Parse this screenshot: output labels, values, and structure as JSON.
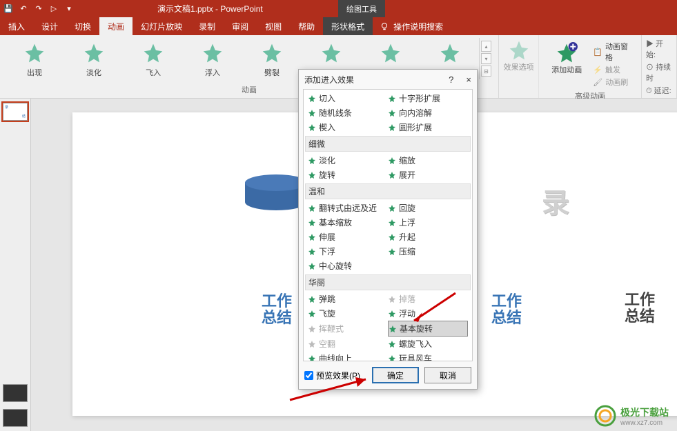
{
  "title": "演示文稿1.pptx  -  PowerPoint",
  "context_group": "绘图工具",
  "tabs": {
    "insert": "插入",
    "design": "设计",
    "transition": "切换",
    "animation": "动画",
    "slideshow": "幻灯片放映",
    "record": "录制",
    "review": "审阅",
    "view": "视图",
    "help": "帮助",
    "shape_format": "形状格式",
    "tell_me": "操作说明搜索"
  },
  "gallery": {
    "items": [
      "出现",
      "淡化",
      "飞入",
      "浮入",
      "劈裂"
    ],
    "group_label": "动画",
    "effect_options": "效果选项",
    "add_animation": "添加动画",
    "adv_group": "高级动画",
    "anim_pane": "动画窗格",
    "trigger": "触发",
    "anim_painter": "动画刷",
    "timing_start": "开始:",
    "timing_duration": "持续时",
    "timing_delay": "延迟:"
  },
  "dialog": {
    "title": "添加进入效果",
    "help": "?",
    "close": "×",
    "rows_basic": [
      [
        "切入",
        "十字形扩展"
      ],
      [
        "随机线条",
        "向内溶解"
      ],
      [
        "楔入",
        "圆形扩展"
      ]
    ],
    "group_subtle": "细微",
    "rows_subtle": [
      [
        "淡化",
        "缩放"
      ],
      [
        "旋转",
        "展开"
      ]
    ],
    "group_moderate": "温和",
    "rows_moderate": [
      [
        "翻转式由远及近",
        "回旋"
      ],
      [
        "基本缩放",
        "上浮"
      ],
      [
        "伸展",
        "升起"
      ],
      [
        "下浮",
        "压缩"
      ],
      [
        "中心旋转",
        ""
      ]
    ],
    "group_exciting": "华丽",
    "rows_exciting": [
      [
        "弹跳",
        "掉落"
      ],
      [
        "飞旋",
        "浮动"
      ],
      [
        "挥鞭式",
        "基本旋转"
      ],
      [
        "空翻",
        "螺旋飞入"
      ],
      [
        "曲线向上",
        "玩具风车"
      ]
    ],
    "preview": "预览效果(P)",
    "ok": "确定",
    "cancel": "取消"
  },
  "slide": {
    "text_a": "工作\n总结",
    "text_b": "工作\n总结",
    "text_c": "工作\n总结",
    "outline": "录"
  },
  "watermark": {
    "name": "极光下载站",
    "url": "www.xz7.com"
  }
}
